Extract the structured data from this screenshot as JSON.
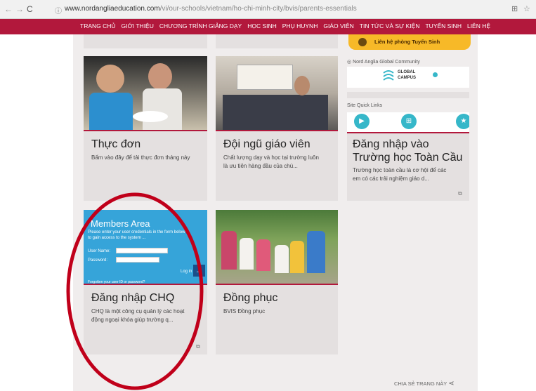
{
  "browser": {
    "url_host": "www.nordangliaeducation.com",
    "url_path": "/vi/our-schools/vietnam/ho-chi-minh-city/bvis/parents-essentials"
  },
  "nav": {
    "items": [
      "TRANG CHỦ",
      "GIỚI THIỆU",
      "CHƯƠNG TRÌNH GIẢNG DẠY",
      "HỌC SINH",
      "PHỤ HUYNH",
      "GIÁO VIÊN",
      "TIN TỨC VÀ SỰ KIỆN",
      "TUYỂN SINH",
      "LIÊN HỆ"
    ]
  },
  "sidebar": {
    "contact_label": "Liên hệ phòng Tuyển Sinh",
    "community_label": "Nord Anglia Global Community",
    "global_campus_line1": "GLOBAL",
    "global_campus_line2": "CAMPUS",
    "quick_links_label": "Site Quick Links"
  },
  "cards": [
    {
      "title": "Thực đơn",
      "desc": "Bấm vào đây để tải thực đơn tháng này"
    },
    {
      "title": "Đội ngũ giáo viên",
      "desc_line1": "Chất lượng dạy và học tại trường luôn",
      "desc_line2": "là ưu tiên hàng đầu của chú..."
    },
    {
      "title_line1": "Đăng nhập vào",
      "title_line2": "Trường học Toàn Cầu",
      "desc_line1": "Trường học toàn cầu là cơ hội để các",
      "desc_line2": "em có các trải nghiệm giáo d..."
    },
    {
      "title": "Đăng nhập CHQ",
      "desc_line1": "CHQ là một công cụ quản lý các hoạt",
      "desc_line2": "động ngoại khóa giúp trường q..."
    },
    {
      "title": "Đồng phục",
      "desc": "BVIS Đồng phục"
    }
  ],
  "members_area": {
    "title": "Members Area",
    "intro_line1": "Please enter your user credentials in the form below",
    "intro_line2": "to gain access to the system ...",
    "user_label": "User Name:",
    "password_label": "Password:",
    "login_label": "Log in",
    "forgot_label": "Forgotten your user ID or password?"
  },
  "share_label": "CHIA SẺ TRANG NÀY",
  "colors": {
    "brand": "#b2183c",
    "accent": "#f7b928",
    "members_bg": "#36a4d9",
    "annotation": "#c0001a"
  }
}
